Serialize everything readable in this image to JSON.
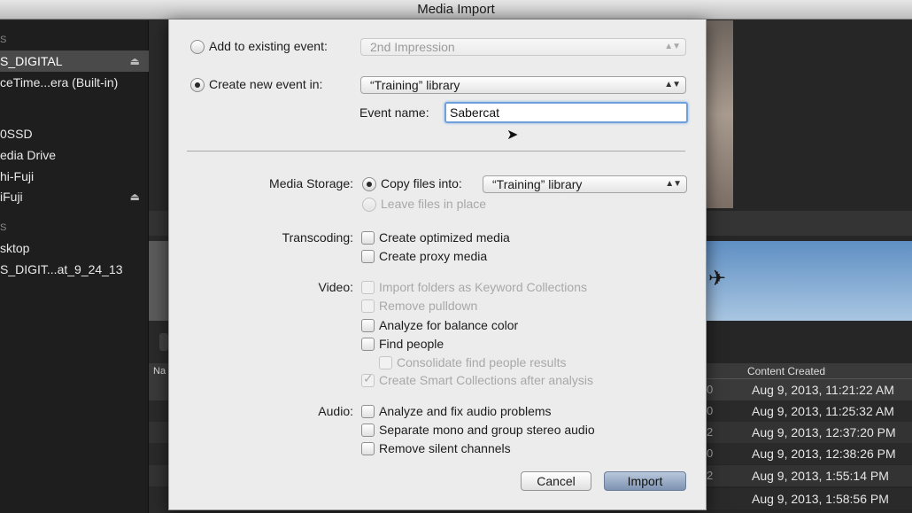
{
  "window": {
    "title": "Media Import"
  },
  "sidebar": {
    "items": [
      {
        "label": "S",
        "kind": "head"
      },
      {
        "label": "S_DIGITAL",
        "selected": true,
        "eject": "⏏"
      },
      {
        "label": "ceTime...era (Built-in)"
      },
      {
        "label": ""
      },
      {
        "label": "0SSD"
      },
      {
        "label": "edia Drive"
      },
      {
        "label": "hi-Fuji"
      },
      {
        "label": "iFuji",
        "eject": "⏏"
      },
      {
        "label": "S",
        "kind": "head"
      },
      {
        "label": "sktop"
      },
      {
        "label": "S_DIGIT...at_9_24_13"
      }
    ]
  },
  "browser": {
    "column_left": "Na",
    "column_header": "Content Created",
    "rows": [
      {
        "num": "0",
        "date": "Aug 9, 2013, 11:21:22 AM"
      },
      {
        "num": "0",
        "date": "Aug 9, 2013, 11:25:32 AM"
      },
      {
        "num": "2",
        "date": "Aug 9, 2013, 12:37:20 PM"
      },
      {
        "num": "0",
        "date": "Aug 9, 2013, 12:38:26 PM"
      },
      {
        "num": "2",
        "date": "Aug 9, 2013, 1:55:14 PM"
      },
      {
        "num": "",
        "date": "Aug 9, 2013, 1:58:56 PM"
      }
    ]
  },
  "dialog": {
    "add_existing_label": "Add to existing event:",
    "add_existing_value": "2nd Impression",
    "create_new_label": "Create new event in:",
    "create_new_value": "“Training” library",
    "event_name_label": "Event name:",
    "event_name_value": "Sabercat",
    "media_storage_label": "Media Storage:",
    "copy_files_label": "Copy files into:",
    "copy_files_value": "“Training” library",
    "leave_files_label": "Leave files in place",
    "transcoding_label": "Transcoding:",
    "create_optimized": "Create optimized media",
    "create_proxy": "Create proxy media",
    "video_label": "Video:",
    "import_folders": "Import folders as Keyword Collections",
    "remove_pulldown": "Remove pulldown",
    "analyze_balance": "Analyze for balance color",
    "find_people": "Find people",
    "consolidate_people": "Consolidate find people results",
    "create_smart": "Create Smart Collections after analysis",
    "audio_label": "Audio:",
    "analyze_audio": "Analyze and fix audio problems",
    "separate_mono": "Separate mono and group stereo audio",
    "remove_silent": "Remove silent channels",
    "cancel_label": "Cancel",
    "import_label": "Import"
  },
  "colors": {
    "focus_ring": "#6ea0dc",
    "default_button": "#8fa3bf"
  }
}
